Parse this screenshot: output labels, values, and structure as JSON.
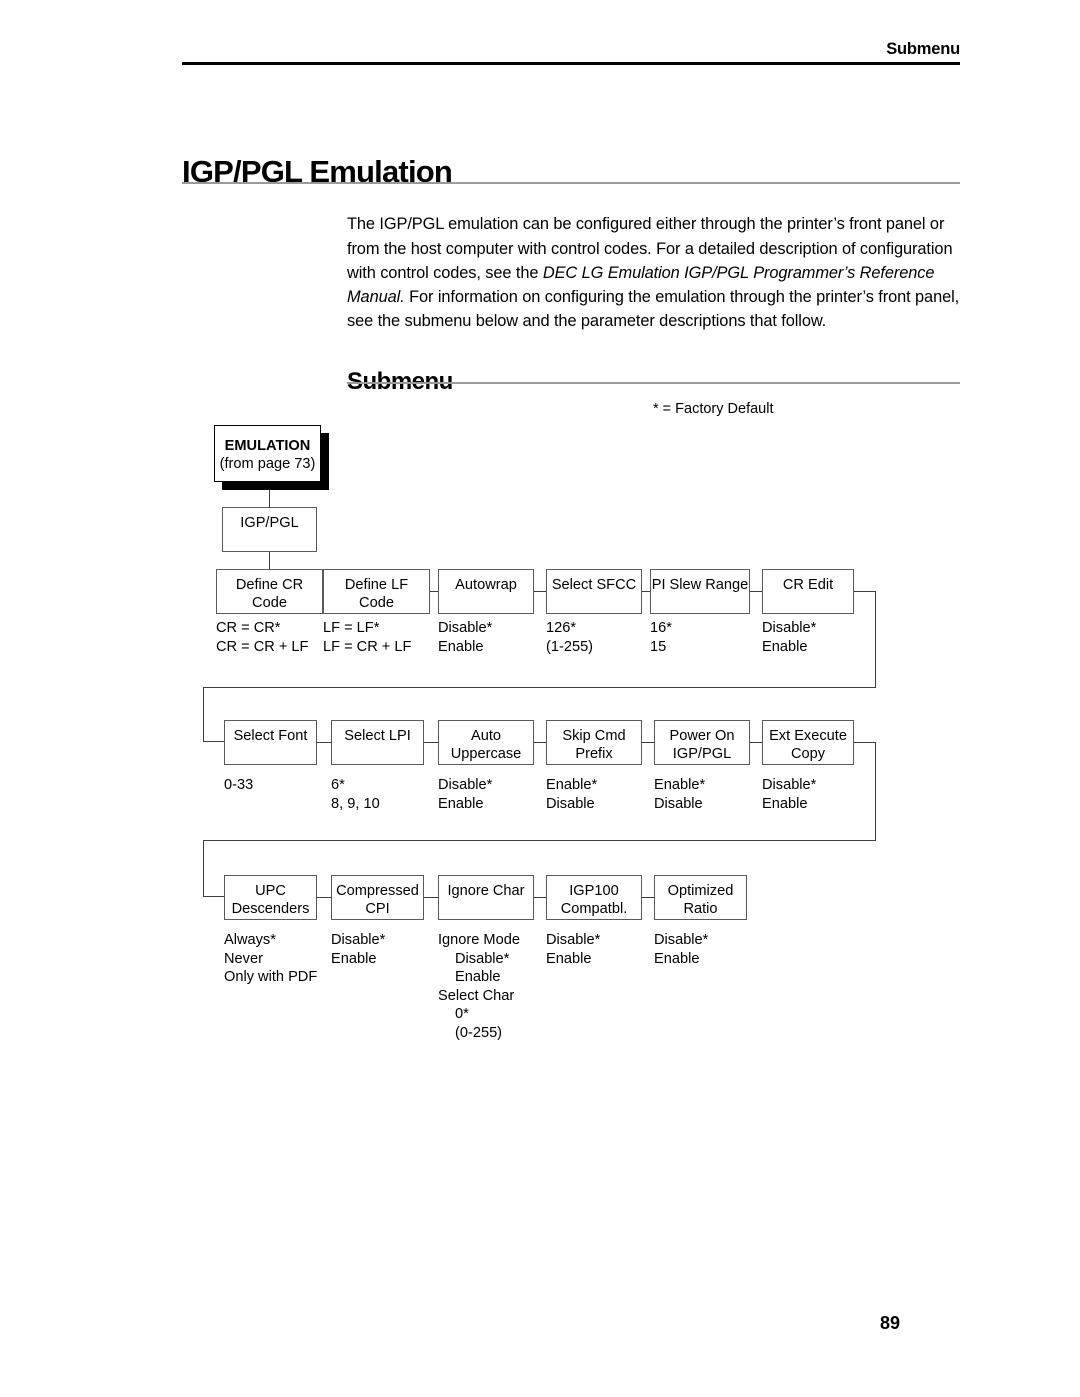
{
  "header": {
    "running_title": "Submenu",
    "page_title": "IGP/PGL Emulation",
    "section_heading": "Submenu"
  },
  "intro": {
    "part1": "The IGP/PGL emulation can be configured either through the printer’s front panel or from the host computer with control codes. For a detailed description of configuration with control codes, see the ",
    "italic": "DEC LG Emulation IGP/PGL Programmer’s Reference Manual.",
    "part2": " For information on configuring the emulation through the printer’s front panel, see the submenu below and the parameter descriptions that follow."
  },
  "legend": "* = Factory Default",
  "diagram": {
    "root": {
      "title": "EMULATION",
      "subtitle": "(from page 73)"
    },
    "branch": "IGP/PGL",
    "rows": [
      {
        "nodes": [
          {
            "label": "Define CR\nCode",
            "options": "CR = CR*\nCR = CR + LF"
          },
          {
            "label": "Define LF\nCode",
            "options": "LF = LF*\nLF = CR + LF"
          },
          {
            "label": "Autowrap",
            "options": "Disable*\nEnable"
          },
          {
            "label": "Select SFCC",
            "options": "126*\n(1-255)"
          },
          {
            "label": "PI Slew Range",
            "options": "16*\n15"
          },
          {
            "label": "CR Edit",
            "options": "Disable*\nEnable"
          }
        ]
      },
      {
        "nodes": [
          {
            "label": "Select Font",
            "options": "0-33"
          },
          {
            "label": "Select LPI",
            "options": "6*\n8, 9, 10"
          },
          {
            "label": "Auto\nUppercase",
            "options": "Disable*\nEnable"
          },
          {
            "label": "Skip Cmd\nPrefix",
            "options": "Enable*\nDisable"
          },
          {
            "label": "Power On\nIGP/PGL",
            "options": "Enable*\nDisable"
          },
          {
            "label": "Ext Execute\nCopy",
            "options": "Disable*\nEnable"
          }
        ]
      },
      {
        "nodes": [
          {
            "label": "UPC\nDescenders",
            "options": "Always*\nNever\nOnly with PDF"
          },
          {
            "label": "Compressed\nCPI",
            "options": "Disable*\nEnable"
          },
          {
            "label": "Ignore Char",
            "options": "Ignore Mode\n  Disable*\n  Enable\nSelect Char\n  0*\n  (0-255)"
          },
          {
            "label": "IGP100\nCompatbl.",
            "options": "Disable*\nEnable"
          },
          {
            "label": "Optimized\nRatio",
            "options": "Disable*\nEnable"
          }
        ]
      }
    ]
  },
  "footer": {
    "page_number": "89"
  }
}
